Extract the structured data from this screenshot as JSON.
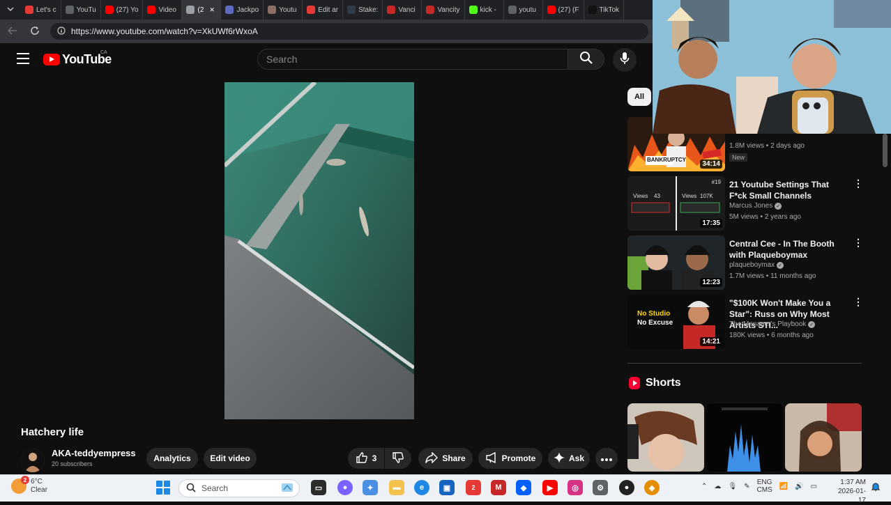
{
  "browser": {
    "tabs": [
      {
        "label": "Let's c",
        "icon": "tiktok-like-icon",
        "color": "#e53935"
      },
      {
        "label": "YouTu",
        "icon": "search-icon",
        "color": "#5f6368"
      },
      {
        "label": "(27) Yo",
        "icon": "youtube-icon",
        "color": "#ff0000"
      },
      {
        "label": "Video",
        "icon": "youtube-icon",
        "color": "#ff0000"
      },
      {
        "label": "(2",
        "icon": "speaker-icon",
        "color": "#9aa0a6",
        "active": true
      },
      {
        "label": "Jackpo",
        "icon": "jc-icon",
        "color": "#5c6bc0"
      },
      {
        "label": "Youtu",
        "icon": "globe-icon",
        "color": "#8d6e63"
      },
      {
        "label": "Edit ar",
        "icon": "edit-icon",
        "color": "#e53935"
      },
      {
        "label": "Stake:",
        "icon": "stake-icon",
        "color": "#2e3a46"
      },
      {
        "label": "Vanci",
        "icon": "v-icon",
        "color": "#c62828"
      },
      {
        "label": "Vancity",
        "icon": "v-icon",
        "color": "#c62828"
      },
      {
        "label": "kick -",
        "icon": "kick-icon",
        "color": "#53fc18"
      },
      {
        "label": "youtu",
        "icon": "search-icon",
        "color": "#5f6368"
      },
      {
        "label": "(27) (F",
        "icon": "youtube-icon",
        "color": "#ff0000"
      },
      {
        "label": "TikTok",
        "icon": "tiktok-icon",
        "color": "#111111"
      }
    ],
    "url": "https://www.youtube.com/watch?v=XkUWf6rWxoA"
  },
  "youtube": {
    "logo_text": "YouTube",
    "country_code": "CA",
    "search_placeholder": "Search"
  },
  "video": {
    "title": "Hatchery life",
    "channel": "AKA-teddyempress",
    "subscribers": "20 subscribers",
    "analytics_label": "Analytics",
    "edit_label": "Edit video",
    "like_count": "3",
    "share_label": "Share",
    "promote_label": "Promote",
    "ask_label": "Ask"
  },
  "sidebar": {
    "chip_all": "All",
    "recommendations": [
      {
        "title": "",
        "channel": "",
        "views": "1.8M views • 2 days ago",
        "badge": "New",
        "duration": "34:14"
      },
      {
        "title": "21 Youtube Settings That F*ck Small Channels",
        "channel": "Marcus Jones",
        "views": "5M views • 2 years ago",
        "duration": "17:35"
      },
      {
        "title": "Central Cee - In The Booth with Plaqueboymax",
        "channel": "plaqueboymax",
        "views": "1.7M views • 11 months ago",
        "duration": "12:23"
      },
      {
        "title": "\"$100K Won't Make You a Star\": Russ on Why Most Artists STI...",
        "channel": "The Manager's Playbook",
        "views": "180K views • 6 months ago",
        "duration": "14:21"
      }
    ],
    "thumb_text": {
      "bankruptcy": "BANKRUPTCY",
      "views_left": "Views",
      "views_left_num": "43",
      "views_right": "Views",
      "views_right_num": "107K",
      "rank": "#19",
      "no_studio": "No Studio",
      "no_excuse": "No Excuse"
    },
    "shorts_title": "Shorts"
  },
  "taskbar": {
    "weather_temp": "6°C",
    "weather_desc": "Clear",
    "weather_badge": "2",
    "search_placeholder": "Search",
    "lang_top": "ENG",
    "lang_bottom": "CMS",
    "time": "1:37 AM",
    "date": "2026-01-17",
    "store_badge": "2"
  }
}
